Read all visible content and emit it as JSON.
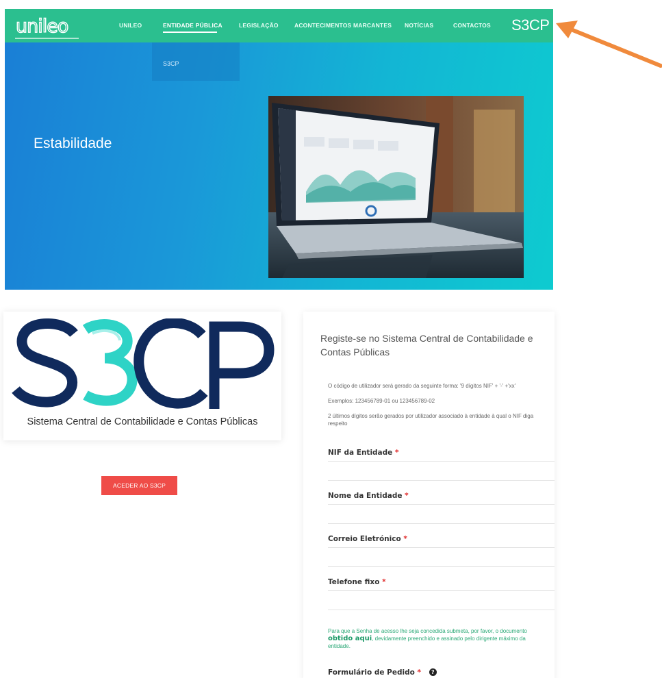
{
  "brand_logo": "unileo",
  "nav": {
    "items": [
      "UNILEO",
      "ENTIDADE PÚBLICA",
      "LEGISLAÇÃO",
      "ACONTECIMENTOS MARCANTES",
      "NOTÍCIAS",
      "CONTACTOS"
    ],
    "active": "ENTIDADE PÚBLICA",
    "brand_right": "S3CP"
  },
  "dropdown": {
    "items": [
      "S3CP"
    ]
  },
  "hero": {
    "title": "Estabilidade"
  },
  "s3cp_card": {
    "logo_text": "S3CP",
    "caption": "Sistema Central de Contabilidade e Contas Públicas"
  },
  "access_button": "ACEDER AO S3CP",
  "form": {
    "title": "Registe-se no Sistema Central de Contabilidade e Contas Públicas",
    "note_1": "O código de utilizador será gerado da seguinte forma: '9 dígitos NIF' + '-' +'xx'",
    "note_2": "Exemplos: 123456789-01 ou 123456789-02",
    "note_3": "2 últimos dígitos serão gerados por utilizador associado à entidade à qual o NIF diga respeito",
    "fields": [
      {
        "label": "NIF da Entidade",
        "required": "*"
      },
      {
        "label": "Nome da Entidade",
        "required": "*"
      },
      {
        "label": "Correio Eletrónico",
        "required": "*"
      },
      {
        "label": "Telefone fixo",
        "required": "*"
      }
    ],
    "green_note_before": "Para que a Senha de acesso lhe seja concedida submeta, por favor, o documento ",
    "green_note_link": "obtido aqui",
    "green_note_after": ", devidamente preenchido e assinado pelo dirigente máximo da entidade.",
    "last_field_label": "Formulário de Pedido",
    "last_field_required": "*",
    "help_icon_glyph": "?"
  },
  "colors": {
    "nav_bg": "#2bbf8f",
    "button_bg": "#ef4c48",
    "arrow": "#f08a3c",
    "logo_navy": "#102a5c",
    "logo_teal": "#2ed3c6"
  }
}
